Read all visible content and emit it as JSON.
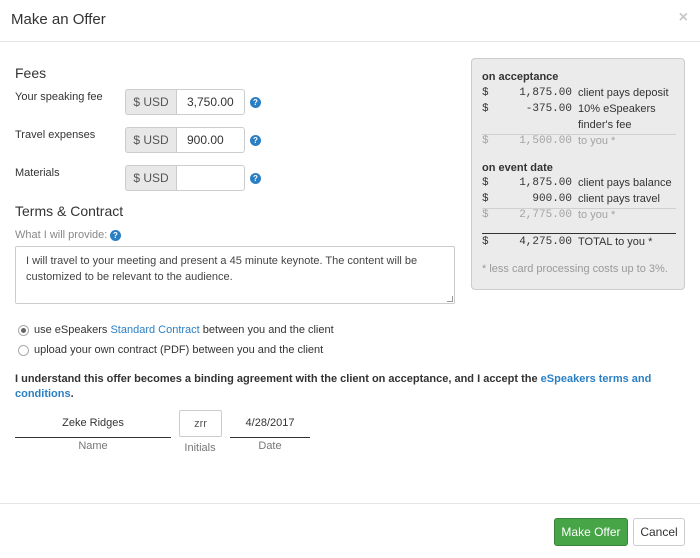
{
  "modal": {
    "title": "Make an Offer",
    "close_glyph": "×"
  },
  "fees": {
    "title": "Fees",
    "speaking": {
      "label": "Your speaking fee",
      "currency": "$ USD",
      "value": "3,750.00"
    },
    "travel": {
      "label": "Travel expenses",
      "currency": "$ USD",
      "value": "900.00"
    },
    "materials": {
      "label": "Materials",
      "currency": "$ USD",
      "value": ""
    },
    "help_glyph": "?"
  },
  "summary": {
    "acceptance": {
      "heading": "on acceptance",
      "rows": [
        {
          "dollar": "$",
          "amount": "1,875.00",
          "desc": "client pays deposit"
        },
        {
          "dollar": "$",
          "amount": "-375.00",
          "desc": "10% eSpeakers"
        },
        {
          "desc_cont": "finder's fee"
        },
        {
          "dollar": "$",
          "amount": "1,500.00",
          "desc": "to you *"
        }
      ]
    },
    "event": {
      "heading": "on event date",
      "rows": [
        {
          "dollar": "$",
          "amount": "1,875.00",
          "desc": "client pays balance"
        },
        {
          "dollar": "$",
          "amount": "900.00",
          "desc": "client pays travel"
        },
        {
          "dollar": "$",
          "amount": "2,775.00",
          "desc": "to you *"
        }
      ]
    },
    "total": {
      "dollar": "$",
      "amount": "4,275.00",
      "desc": "TOTAL to you *"
    },
    "note": "* less card processing costs up to 3%."
  },
  "terms": {
    "title": "Terms & Contract",
    "provide_label": "What I will provide:",
    "provide_text": "I will travel to your meeting and present a 45 minute keynote. The content will be customized to be relevant to the audience.",
    "radio1": {
      "pre": "use eSpeakers ",
      "link": "Standard Contract",
      "post": " between you and the client"
    },
    "radio2": {
      "label": "upload your own contract (PDF) between you and the client"
    }
  },
  "agreement": {
    "text": "I understand this offer becomes a binding agreement with the client on acceptance, and I accept the ",
    "link": "eSpeakers terms and conditions",
    "end": "."
  },
  "signature": {
    "name_value": "Zeke Ridges",
    "name_label": "Name",
    "initials_value": "zrr",
    "initials_label": "Initials",
    "date_value": "4/28/2017",
    "date_label": "Date"
  },
  "footer": {
    "submit_label": "Make Offer",
    "cancel_label": "Cancel"
  },
  "colors": {
    "primary": "#47a447",
    "link": "#2a7fc4"
  }
}
